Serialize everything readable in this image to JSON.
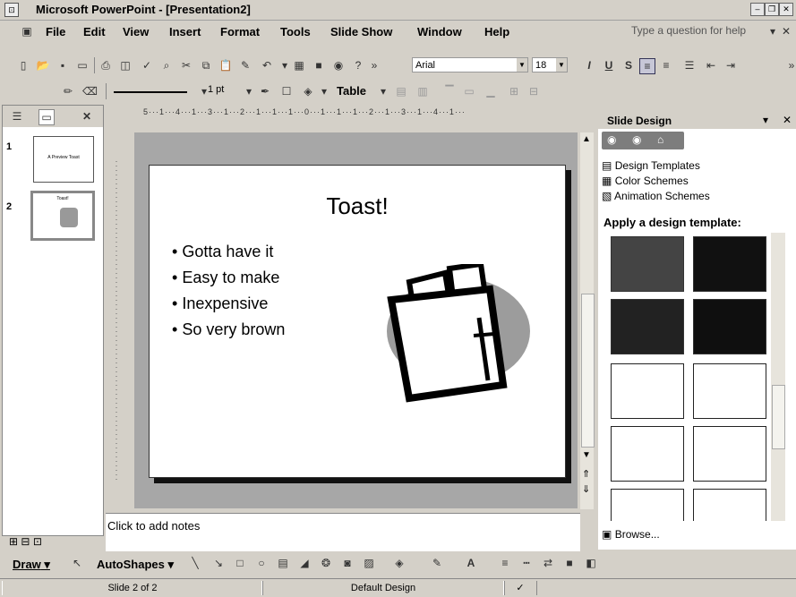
{
  "window": {
    "title": "Microsoft PowerPoint - [Presentation2]"
  },
  "menu": {
    "items": [
      "File",
      "Edit",
      "View",
      "Insert",
      "Format",
      "Tools",
      "Slide Show",
      "Window",
      "Help"
    ],
    "help_placeholder": "Type a question for help"
  },
  "formatting": {
    "font_name": "Arial",
    "font_size": "18"
  },
  "drawing_toolbar": {
    "line_weight": "1 pt",
    "table_label": "Table"
  },
  "slides": [
    {
      "number": "1",
      "title": "A Preview Toast"
    },
    {
      "number": "2",
      "title": "Toast!"
    }
  ],
  "slide": {
    "title": "Toast!",
    "bullets": [
      "Gotta have it",
      "Easy to make",
      "Inexpensive",
      "So very brown"
    ]
  },
  "ruler": {
    "horizontal": "5···1···4···1···3···1···2···1···1···1···0···1···1···1···2···1···3···1···4···1···"
  },
  "notes": {
    "placeholder": "Click to add notes"
  },
  "task_pane": {
    "title": "Slide Design",
    "links": [
      "Design Templates",
      "Color Schemes",
      "Animation Schemes"
    ],
    "section_heading": "Apply a design template:",
    "browse_label": "Browse..."
  },
  "draw_bar": {
    "draw_label": "Draw",
    "autoshapes_label": "AutoShapes"
  },
  "status": {
    "slide_position": "Slide 2 of 2",
    "design": "Default Design"
  }
}
